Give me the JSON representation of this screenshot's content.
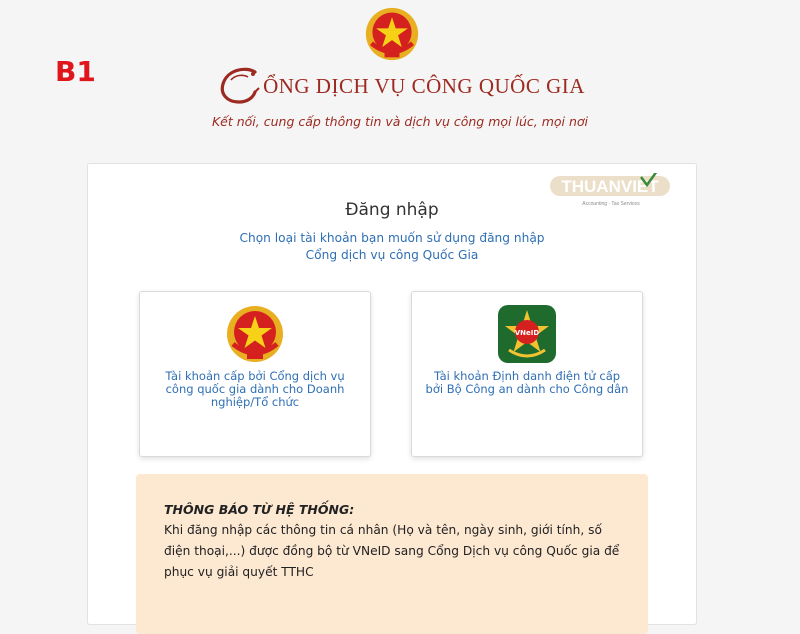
{
  "step_label": "B1",
  "brand": {
    "title": "ỔNG DỊCH VỤ CÔNG QUỐC GIA",
    "tagline": "Kết nối, cung cấp thông tin và dịch vụ công mọi lúc, mọi nơi",
    "color": "#9c2a21"
  },
  "watermark": {
    "text": "THUANVIET",
    "subtext": "Accounting · Tax Services"
  },
  "login": {
    "title": "Đăng nhập",
    "desc_line1": "Chọn loại tài khoản bạn muốn sử dụng đăng nhập",
    "desc_line2": "Cổng dịch vụ công Quốc Gia"
  },
  "options": [
    {
      "icon": "national-emblem-icon",
      "label": "Tài khoản cấp bởi Cổng dịch vụ công quốc gia dành cho Doanh nghiệp/Tổ chức"
    },
    {
      "icon": "vneid-icon",
      "badge_text": "VNeID",
      "label": "Tài khoản Định danh điện tử cấp bởi Bộ Công an dành cho Công dân"
    }
  ],
  "notice": {
    "title": "THÔNG BÁO TỪ HỆ THỐNG:",
    "body": "Khi đăng nhập các thông tin cá nhân (Họ và tên, ngày sinh, giới tính, số điện thoại,...) được đồng bộ từ VNeID sang Cổng Dịch vụ công Quốc gia để phục vụ giải quyết TTHC"
  },
  "colors": {
    "accent_red": "#e0161d",
    "link_blue": "#2f6fb5",
    "notice_bg": "#fde8d2"
  }
}
